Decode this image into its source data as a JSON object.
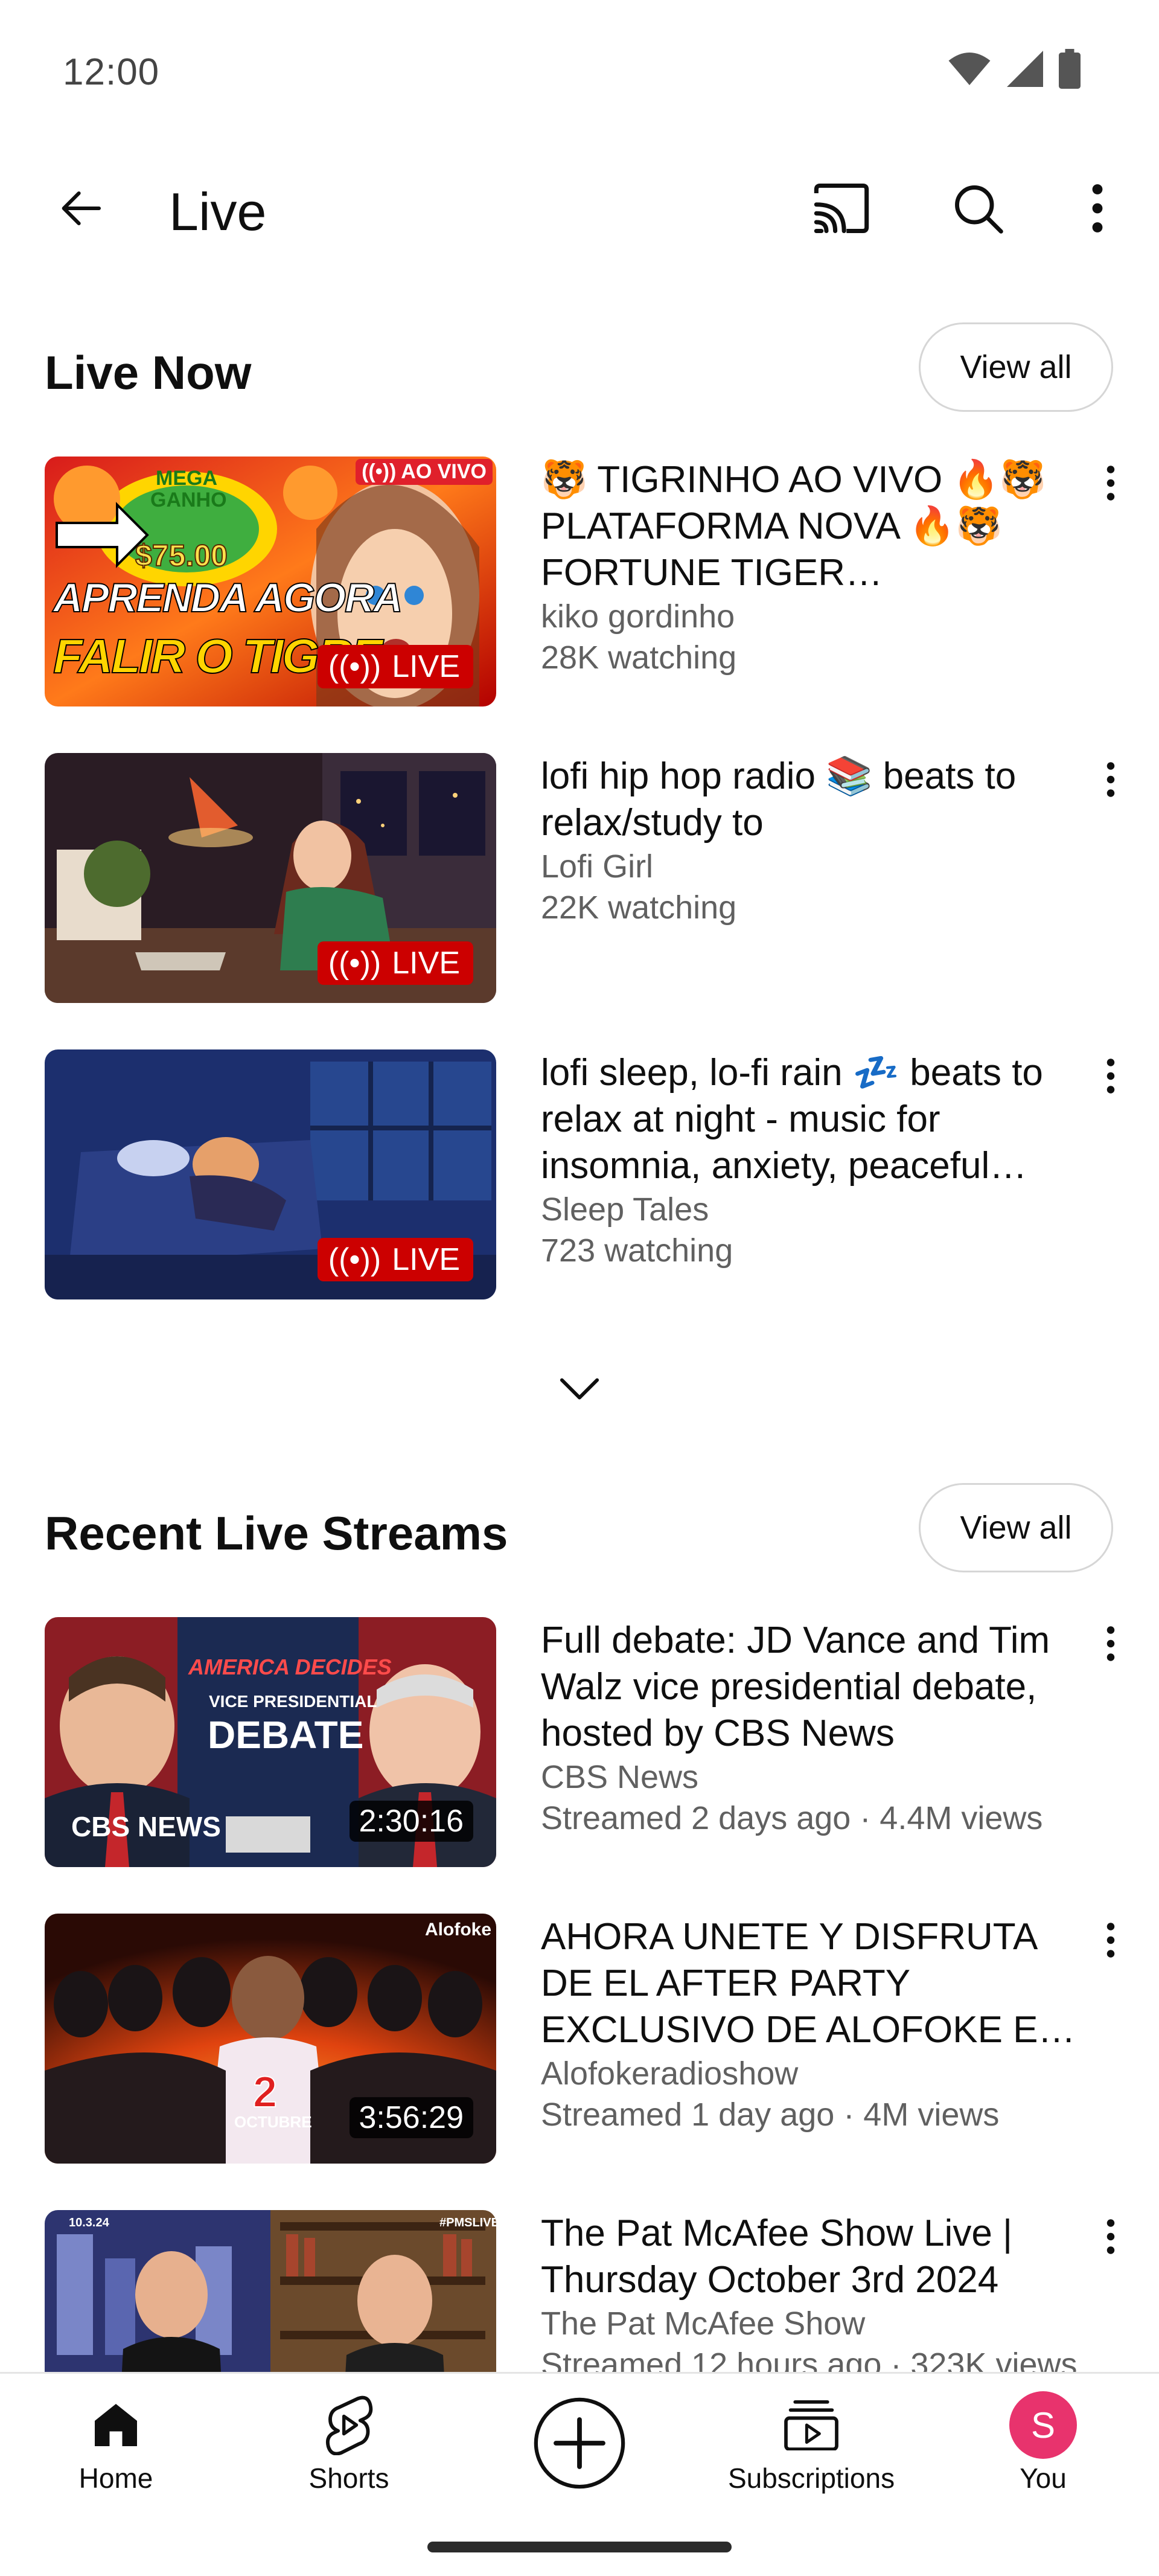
{
  "status_bar": {
    "time": "12:00"
  },
  "app_bar": {
    "title": "Live"
  },
  "sections": {
    "live_now": {
      "title": "Live Now",
      "view_all_label": "View all",
      "items": [
        {
          "title": "🐯 TIGRINHO AO VIVO 🔥🐯 PLATAFORMA NOVA 🔥🐯 FORTUNE TIGER ESTRATEGIA",
          "channel": "kiko gordinho",
          "stats": "28K watching",
          "badge": "LIVE",
          "thumb_text": {
            "tag": "AO VIVO",
            "value": "$75.00",
            "line1": "APRENDA AGORA",
            "line2": "FALIR O TIGRE",
            "brand": "MEGA GANHO"
          }
        },
        {
          "title": "lofi hip hop radio 📚 beats to relax/study to",
          "channel": "Lofi Girl",
          "stats": "22K watching",
          "badge": "LIVE"
        },
        {
          "title": "lofi sleep, lo-fi rain 💤 beats to relax at night - music for insomnia, anxiety, peaceful dreams",
          "channel": "Sleep Tales",
          "stats": "723 watching",
          "badge": "LIVE"
        }
      ]
    },
    "recent": {
      "title": "Recent Live Streams",
      "view_all_label": "View all",
      "items": [
        {
          "title": "Full debate: JD Vance and Tim Walz vice presidential debate, hosted by CBS News",
          "channel": "CBS News",
          "stats": "Streamed 2 days ago · 4.4M views",
          "duration": "2:30:16",
          "thumb_text": {
            "top": "AMERICA DECIDES",
            "mid": "VICE PRESIDENTIAL",
            "big": "DEBATE",
            "brand": "CBS NEWS"
          }
        },
        {
          "title": "AHORA UNETE Y DISFRUTA DE EL AFTER PARTY EXCLUSIVO DE ALOFOKE EN VIVO",
          "channel": "Alofokeradioshow",
          "stats": "Streamed 1 day ago · 4M views",
          "duration": "3:56:29",
          "thumb_text": {
            "num": "2",
            "month": "OCTUBRE",
            "brand": "Alofoke"
          }
        },
        {
          "title": "The Pat McAfee Show Live | Thursday October 3rd 2024",
          "channel": "The Pat McAfee Show",
          "stats": "Streamed 12 hours ago · 323K views",
          "thumb_text": {
            "tag": "#PMSLIVE",
            "date": "10.3.24"
          }
        }
      ]
    }
  },
  "bottom_nav": {
    "home": "Home",
    "shorts": "Shorts",
    "subscriptions": "Subscriptions",
    "you": "You",
    "avatar_letter": "S"
  },
  "colors": {
    "live_red": "#cc0000",
    "avatar_pink": "#e8336d",
    "secondary_text": "#606060"
  }
}
